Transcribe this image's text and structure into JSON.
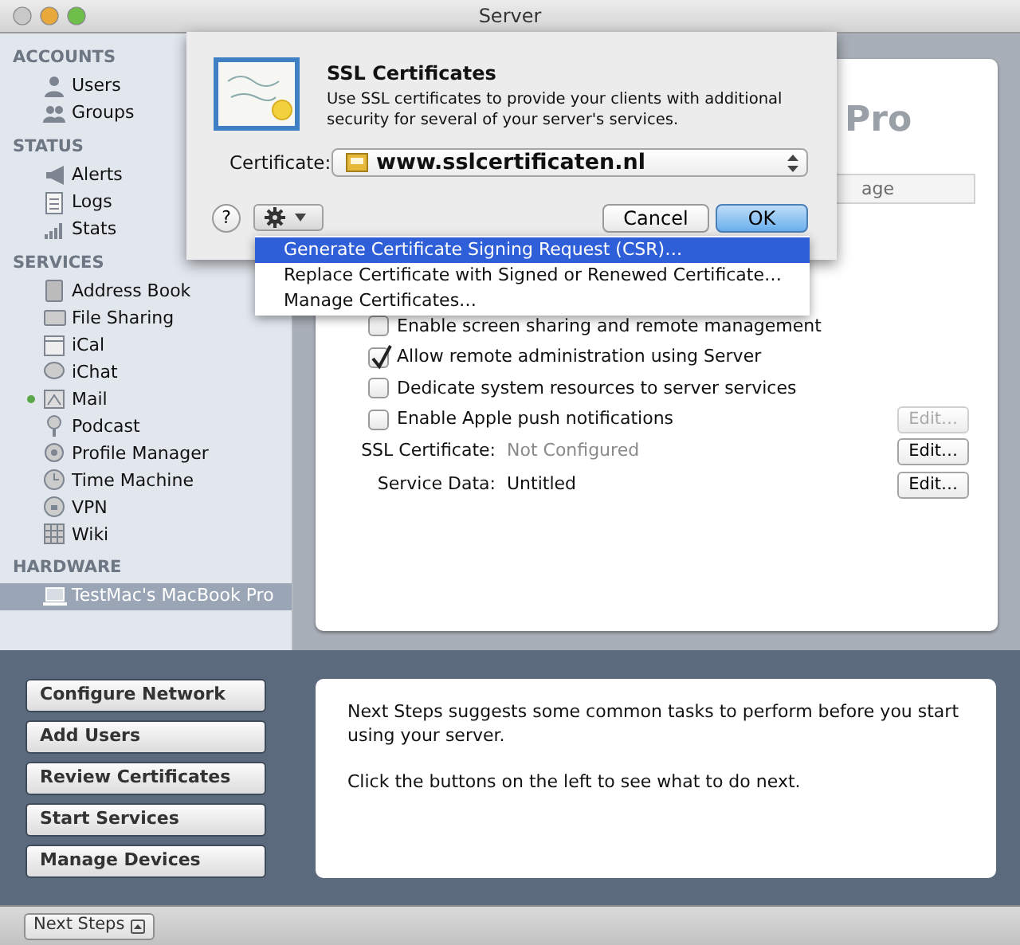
{
  "window": {
    "title": "Server"
  },
  "sidebar": {
    "sections": [
      {
        "title": "ACCOUNTS",
        "items": [
          {
            "label": "Users",
            "selected": false
          },
          {
            "label": "Groups",
            "selected": false
          }
        ]
      },
      {
        "title": "STATUS",
        "items": [
          {
            "label": "Alerts",
            "selected": false
          },
          {
            "label": "Logs",
            "selected": false
          },
          {
            "label": "Stats",
            "selected": false
          }
        ]
      },
      {
        "title": "SERVICES",
        "items": [
          {
            "label": "Address Book",
            "selected": false
          },
          {
            "label": "File Sharing",
            "selected": false
          },
          {
            "label": "iCal",
            "selected": false
          },
          {
            "label": "iChat",
            "selected": false
          },
          {
            "label": "Mail",
            "selected": false,
            "color": "#5aa84a"
          },
          {
            "label": "Podcast",
            "selected": false
          },
          {
            "label": "Profile Manager",
            "selected": false
          },
          {
            "label": "Time Machine",
            "selected": false
          },
          {
            "label": "VPN",
            "selected": false
          },
          {
            "label": "Wiki",
            "selected": false
          }
        ]
      },
      {
        "title": "HARDWARE",
        "items": [
          {
            "label": "TestMac's MacBook Pro",
            "selected": true
          }
        ]
      }
    ]
  },
  "main": {
    "heading": "Pro",
    "tab": "age",
    "settings": [
      {
        "kind": "checkbox",
        "label": "Enable screen sharing and remote management",
        "checked": false
      },
      {
        "kind": "checkbox",
        "label": "Allow remote administration using Server",
        "checked": true
      },
      {
        "kind": "checkbox",
        "label": "Dedicate system resources to server services",
        "checked": false
      },
      {
        "kind": "checkbox",
        "label": "Enable Apple push notifications",
        "checked": false,
        "button": {
          "label": "Edit…",
          "disabled": true
        }
      },
      {
        "kind": "field",
        "label": "SSL Certificate:",
        "value": "Not Configured",
        "dimmed": true,
        "button": {
          "label": "Edit…",
          "disabled": false
        }
      },
      {
        "kind": "field",
        "label": "Service Data:",
        "value": "Untitled",
        "dimmed": false,
        "button": {
          "label": "Edit…",
          "disabled": false
        }
      }
    ]
  },
  "dialog": {
    "title": "SSL Certificates",
    "description": "Use SSL certificates to provide your clients with additional security for several of your server's services.",
    "certificate_label": "Certificate:",
    "certificate_value": "www.sslcertificaten.nl",
    "help_button": "?",
    "buttons": [
      {
        "label": "Cancel",
        "default": false
      },
      {
        "label": "OK",
        "default": true
      }
    ]
  },
  "menu": {
    "items": [
      {
        "label": "Generate Certificate Signing Request (CSR)…",
        "selected": true
      },
      {
        "label": "Replace Certificate with Signed or Renewed Certificate…",
        "selected": false
      },
      {
        "label": "Manage Certificates…",
        "selected": false
      }
    ]
  },
  "next_steps": {
    "buttons": [
      "Configure Network",
      "Add Users",
      "Review Certificates",
      "Start Services",
      "Manage Devices"
    ],
    "paragraphs": [
      "Next Steps suggests some common tasks to perform before you start using your server.",
      "Click the buttons on the left to see what to do next."
    ]
  },
  "status_bar": {
    "button": "Next Steps"
  }
}
